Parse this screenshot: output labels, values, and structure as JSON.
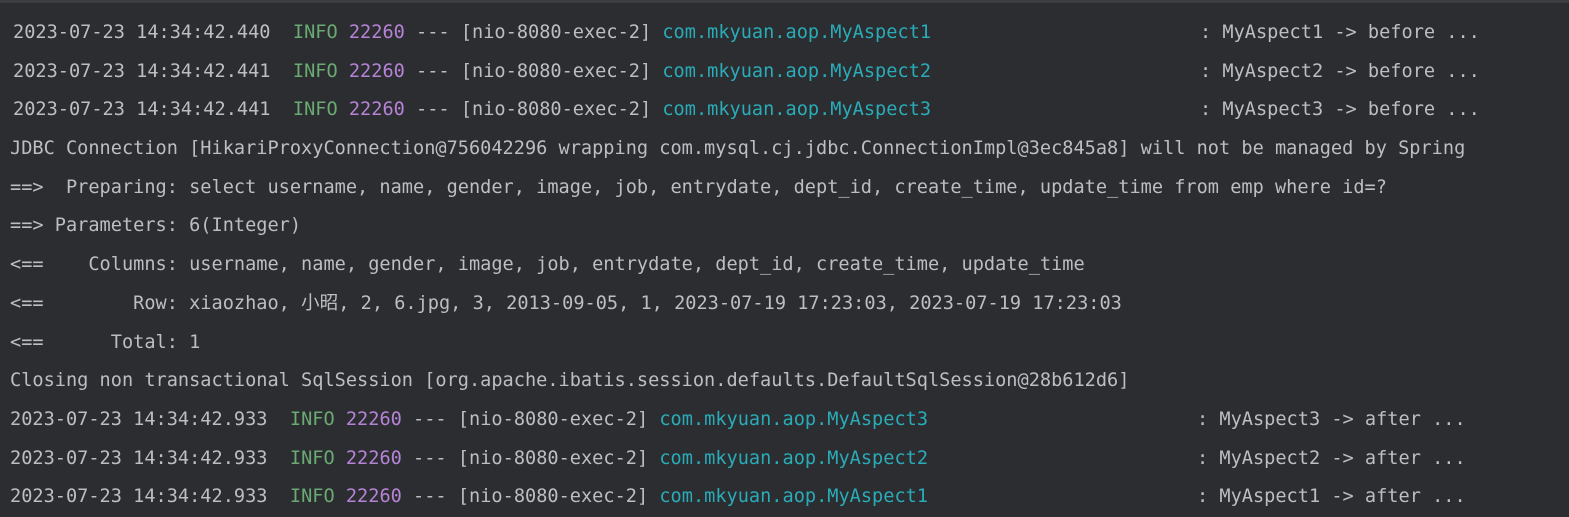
{
  "colors": {
    "background": "#2b2d30",
    "text": "#bcbec4",
    "level": "#6aab73",
    "pid": "#b683d6",
    "logger": "#2aacb8"
  },
  "console": {
    "before_lines": [
      {
        "ts": "2023-07-23 14:34:42.440",
        "level": "INFO",
        "pid": "22260",
        "dash": "---",
        "thread": "[nio-8080-exec-2]",
        "logger": "com.mkyuan.aop.MyAspect1",
        "message": ": MyAspect1 -> before ..."
      },
      {
        "ts": "2023-07-23 14:34:42.441",
        "level": "INFO",
        "pid": "22260",
        "dash": "---",
        "thread": "[nio-8080-exec-2]",
        "logger": "com.mkyuan.aop.MyAspect2",
        "message": ": MyAspect2 -> before ..."
      },
      {
        "ts": "2023-07-23 14:34:42.441",
        "level": "INFO",
        "pid": "22260",
        "dash": "---",
        "thread": "[nio-8080-exec-2]",
        "logger": "com.mkyuan.aop.MyAspect3",
        "message": ": MyAspect3 -> before ..."
      }
    ],
    "plain_lines": [
      "JDBC Connection [HikariProxyConnection@756042296 wrapping com.mysql.cj.jdbc.ConnectionImpl@3ec845a8] will not be managed by Spring",
      "==>  Preparing: select username, name, gender, image, job, entrydate, dept_id, create_time, update_time from emp where id=?",
      "==> Parameters: 6(Integer)",
      "<==    Columns: username, name, gender, image, job, entrydate, dept_id, create_time, update_time",
      "<==        Row: xiaozhao, 小昭, 2, 6.jpg, 3, 2013-09-05, 1, 2023-07-19 17:23:03, 2023-07-19 17:23:03",
      "<==      Total: 1",
      "Closing non transactional SqlSession [org.apache.ibatis.session.defaults.DefaultSqlSession@28b612d6]"
    ],
    "after_lines": [
      {
        "ts": "2023-07-23 14:34:42.933",
        "level": "INFO",
        "pid": "22260",
        "dash": "---",
        "thread": "[nio-8080-exec-2]",
        "logger": "com.mkyuan.aop.MyAspect3",
        "message": ": MyAspect3 -> after ..."
      },
      {
        "ts": "2023-07-23 14:34:42.933",
        "level": "INFO",
        "pid": "22260",
        "dash": "---",
        "thread": "[nio-8080-exec-2]",
        "logger": "com.mkyuan.aop.MyAspect2",
        "message": ": MyAspect2 -> after ..."
      },
      {
        "ts": "2023-07-23 14:34:42.933",
        "level": "INFO",
        "pid": "22260",
        "dash": "---",
        "thread": "[nio-8080-exec-2]",
        "logger": "com.mkyuan.aop.MyAspect1",
        "message": ": MyAspect1 -> after ..."
      }
    ]
  }
}
